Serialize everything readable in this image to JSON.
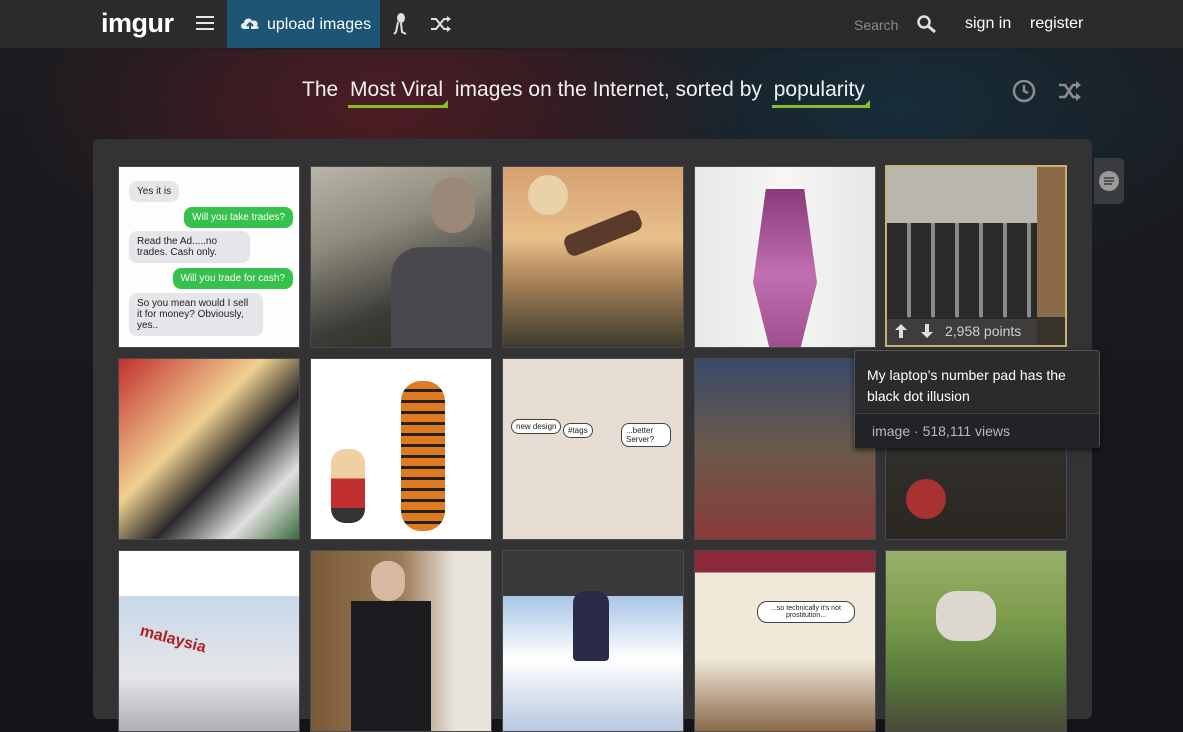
{
  "header": {
    "logo": "imgur",
    "upload_label": "upload images",
    "search_placeholder": "Search",
    "signin_label": "sign in",
    "register_label": "register"
  },
  "headline": {
    "prefix": "The",
    "section": "Most Viral",
    "middle": "images on the Internet, sorted by",
    "sort": "popularity"
  },
  "colors": {
    "accent_green": "#85bf25",
    "upload_blue": "#1c5575",
    "topbar": "#2b2b2b"
  },
  "chat_thumb": {
    "messages": [
      {
        "side": "left",
        "text": "Yes it is"
      },
      {
        "side": "right",
        "text": "Will you take trades?"
      },
      {
        "side": "left",
        "text": "Read the Ad.....no trades. Cash only."
      },
      {
        "side": "right",
        "text": "Will you trade for cash?"
      },
      {
        "side": "left",
        "text": "So you mean would I sell it for money? Obviously, yes.."
      }
    ]
  },
  "gallery": {
    "hovered": {
      "points": "2,958 points",
      "title": "My laptop's number pad has the black dot illusion",
      "meta": "image · 518,111 views"
    },
    "thumbs": [
      {
        "name": "chat-screenshot"
      },
      {
        "name": "guy-selfie"
      },
      {
        "name": "spaceship-sunset"
      },
      {
        "name": "purple-tie-knot"
      },
      {
        "name": "laptop-numpad"
      },
      {
        "name": "comic-harley"
      },
      {
        "name": "calvin-hobbes"
      },
      {
        "name": "boardroom-meme"
      },
      {
        "name": "community-screenshot"
      },
      {
        "name": "hand-with-can"
      },
      {
        "name": "airplane-post"
      },
      {
        "name": "veteran-salute"
      },
      {
        "name": "batman-comic"
      },
      {
        "name": "family-guy-comic"
      },
      {
        "name": "muddy-walker"
      }
    ],
    "comic_texts": {
      "boardroom": [
        "new design",
        "#tags",
        "...better Server?"
      ],
      "family_guy": "...so technically it's not prostitution...",
      "airplane": "malaysia"
    }
  }
}
